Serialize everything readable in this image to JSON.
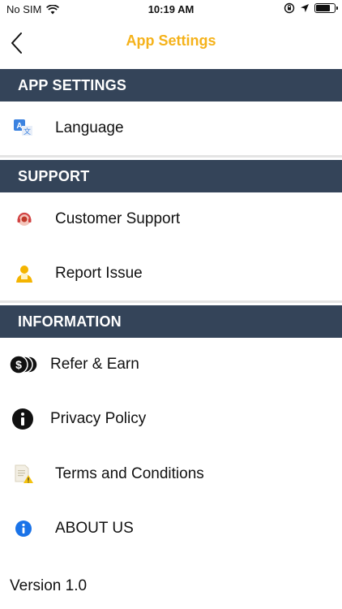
{
  "status_bar": {
    "carrier": "No SIM",
    "time": "10:19 AM",
    "battery_level": 0.75
  },
  "nav": {
    "title": "App Settings",
    "back_icon": "chevron-left-icon"
  },
  "sections": {
    "app_settings": {
      "title": "APP SETTINGS",
      "items": [
        {
          "label": "Language",
          "icon": "translate-icon"
        }
      ]
    },
    "support": {
      "title": "SUPPORT",
      "items": [
        {
          "label": "Customer Support",
          "icon": "headset-icon"
        },
        {
          "label": "Report Issue",
          "icon": "report-person-icon"
        }
      ]
    },
    "information": {
      "title": "INFORMATION",
      "items": [
        {
          "label": "Refer & Earn",
          "icon": "coins-icon"
        },
        {
          "label": "Privacy Policy",
          "icon": "info-filled-icon"
        },
        {
          "label": "Terms and Conditions",
          "icon": "document-warning-icon"
        },
        {
          "label": "ABOUT US",
          "icon": "info-blue-icon"
        }
      ]
    }
  },
  "footer": {
    "version": "Version 1.0"
  },
  "colors": {
    "accent": "#f5b21a",
    "section_header_bg": "#344459",
    "info_blue": "#1a73e8"
  }
}
